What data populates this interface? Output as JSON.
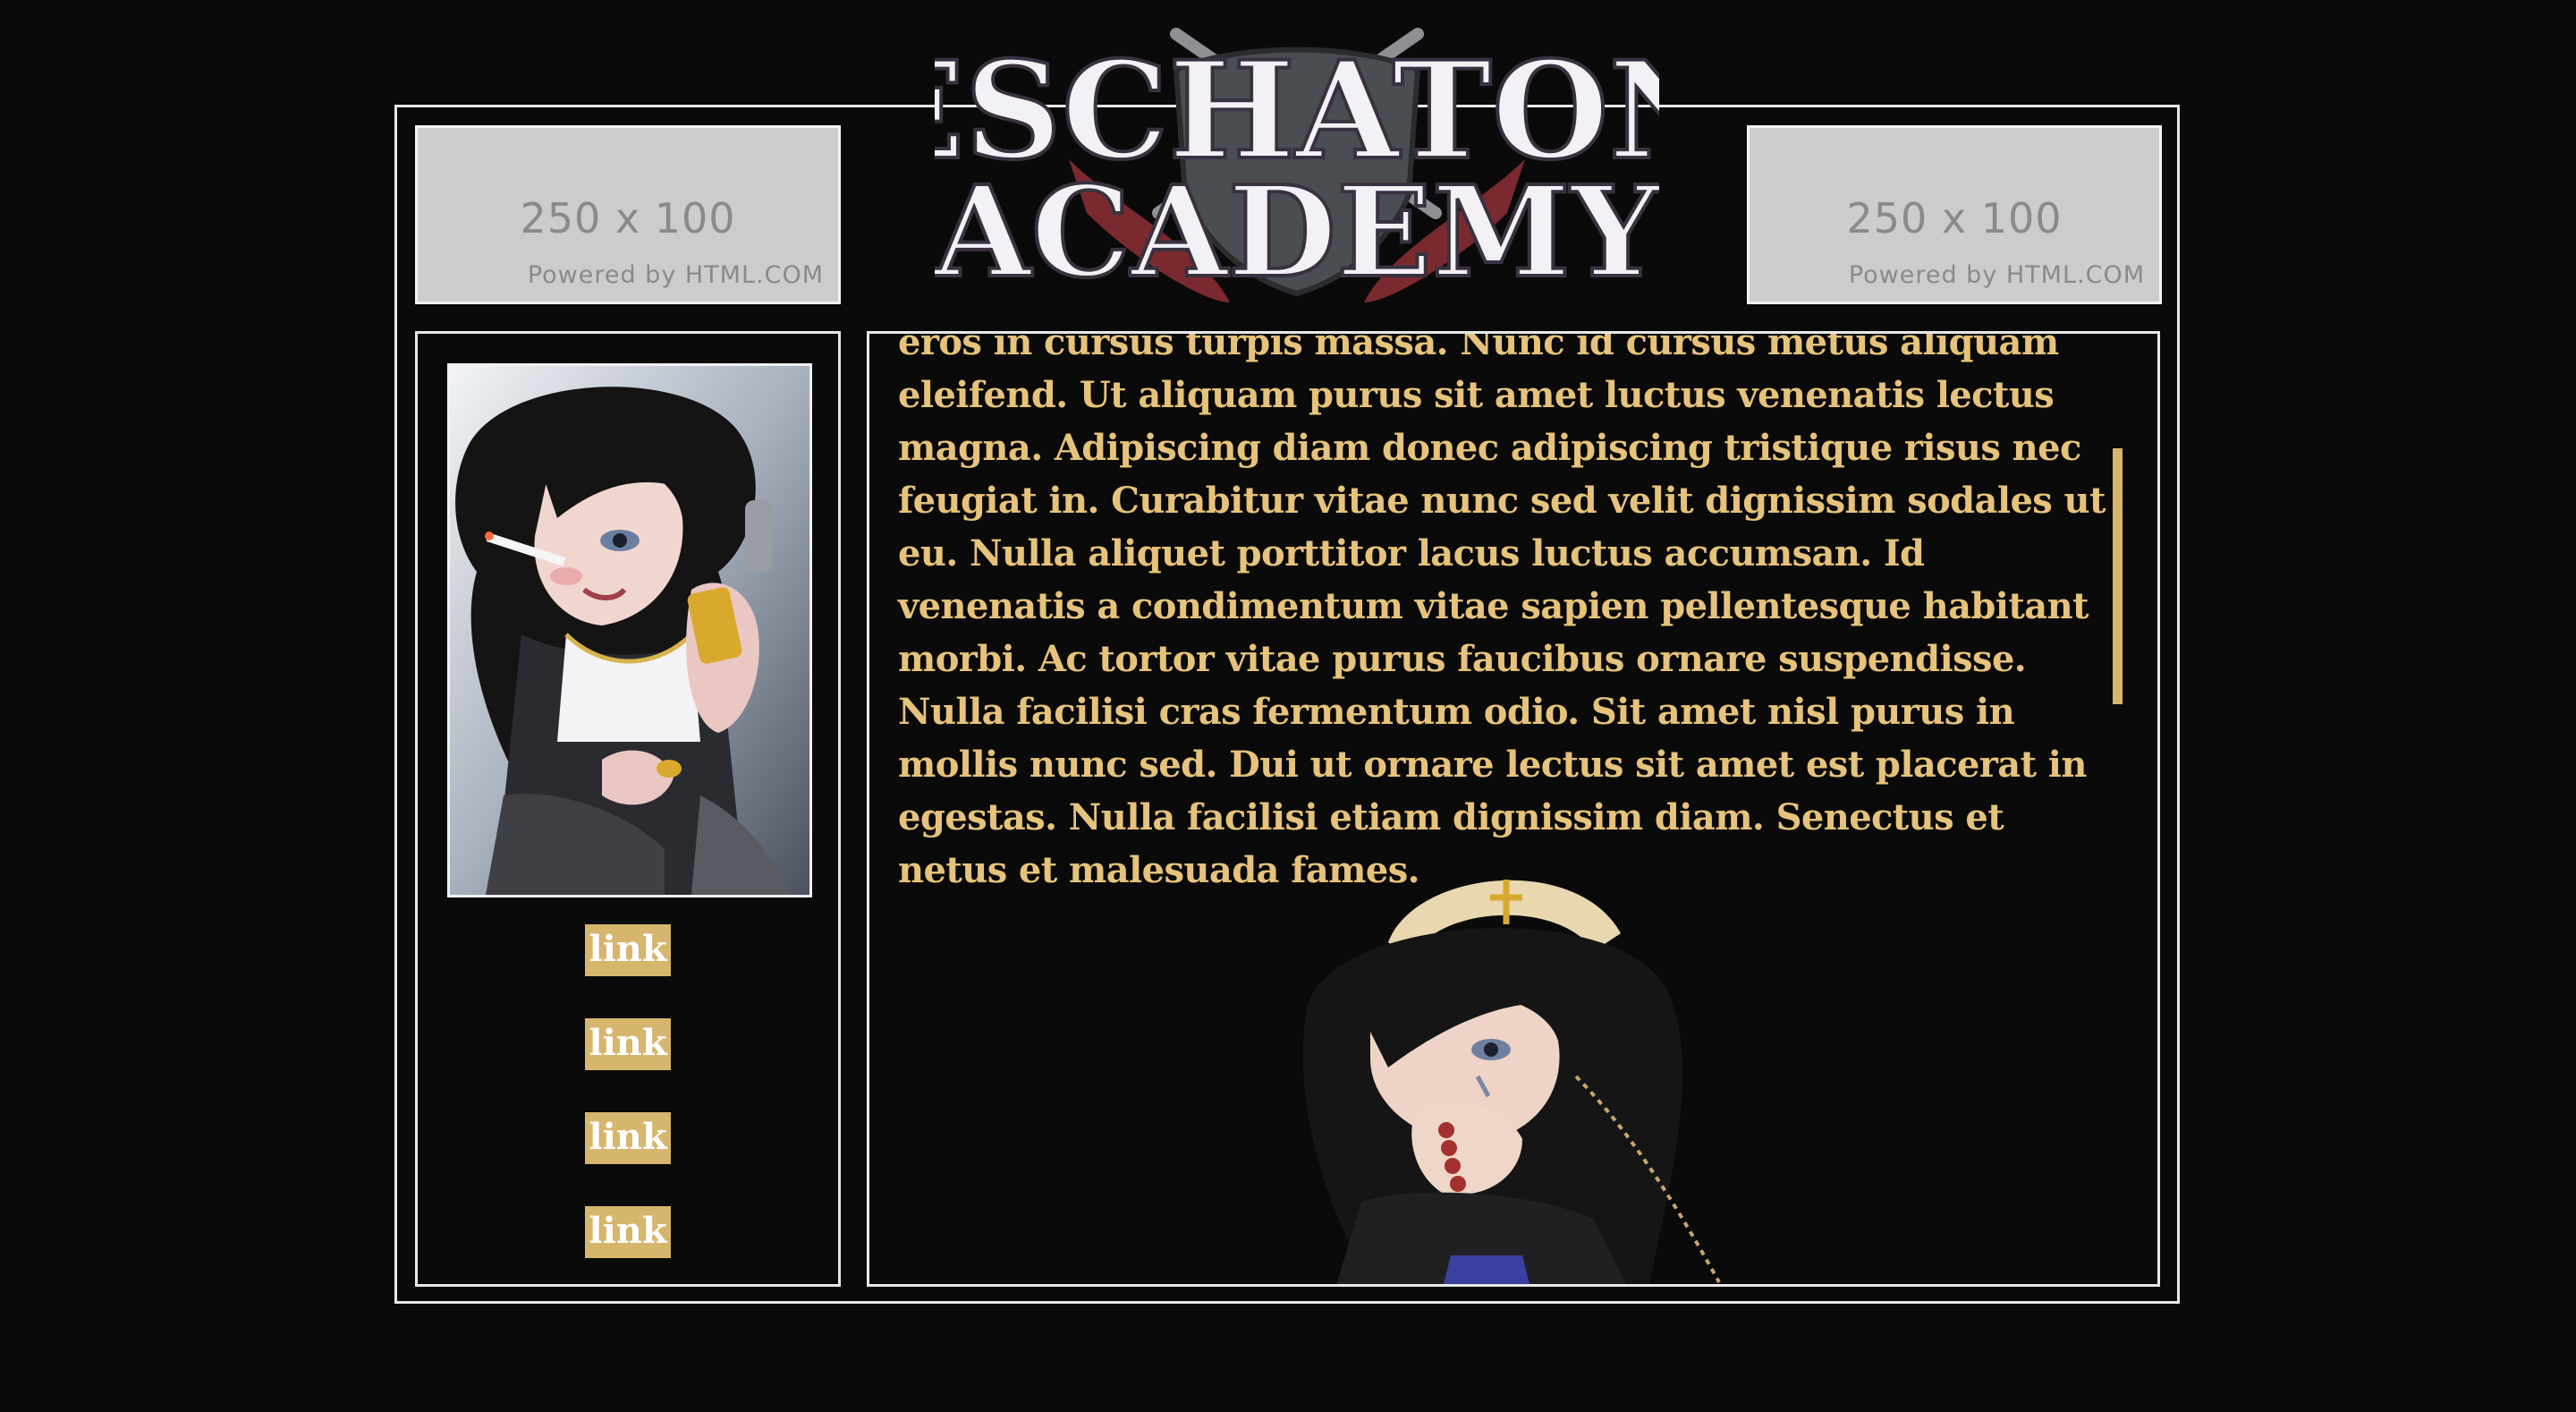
{
  "header": {
    "logo_line1": "ESCHATON",
    "logo_line2": "ACADEMY"
  },
  "ads": {
    "left": {
      "size": "250 x 100",
      "powered": "Powered by HTML.COM"
    },
    "right": {
      "size": "250 x 100",
      "powered": "Powered by HTML.COM"
    }
  },
  "sidebar": {
    "links": [
      {
        "label": "link"
      },
      {
        "label": "link"
      },
      {
        "label": "link"
      },
      {
        "label": "link"
      }
    ]
  },
  "main": {
    "body_text": "eros in cursus turpis massa. Nunc id cursus metus aliquam eleifend. Ut aliquam purus sit amet luctus venenatis lectus magna. Adipiscing diam donec adipiscing tristique risus nec feugiat in. Curabitur vitae nunc sed velit dignissim sodales ut eu. Nulla aliquet porttitor lacus luctus accumsan. Id venenatis a condimentum vitae sapien pellentesque habitant morbi. Ac tortor vitae purus faucibus ornare suspendisse. Nulla facilisi cras fermentum odio. Sit amet nisl purus in mollis nunc sed. Dui ut ornare lectus sit amet est placerat in egestas. Nulla facilisi etiam dignissim diam. Senectus et netus et malesuada fames."
  },
  "colors": {
    "background": "#0a0a0a",
    "accent_gold": "#d6b56c",
    "text_gold": "#e6c27a",
    "border": "#e8e8e8"
  }
}
